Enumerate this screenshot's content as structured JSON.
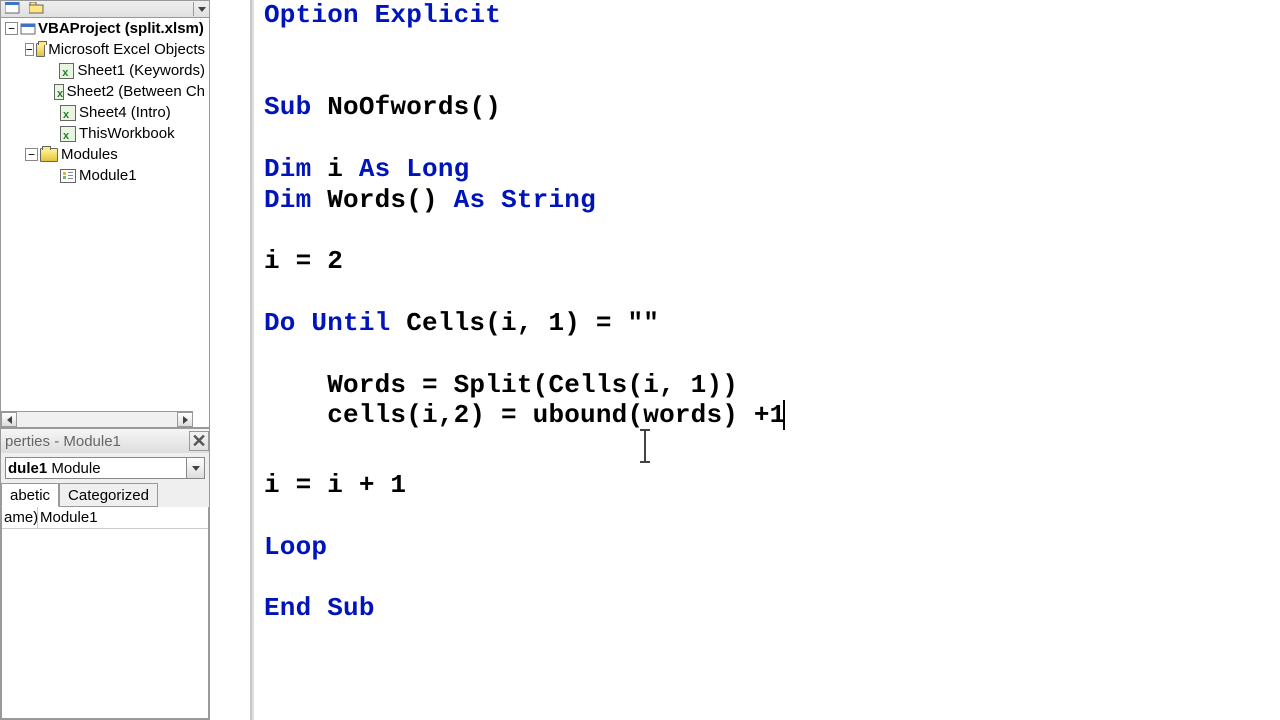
{
  "toolbar": {
    "dropdown": "▾"
  },
  "tree": {
    "project": "VBAProject (split.xlsm)",
    "group_excel": "Microsoft Excel Objects",
    "sheet1": "Sheet1 (Keywords)",
    "sheet2": "Sheet2 (Between Ch",
    "sheet4": "Sheet4 (Intro)",
    "thiswb": "ThisWorkbook",
    "group_modules": "Modules",
    "module1": "Module1"
  },
  "properties": {
    "title": "perties - Module1",
    "combo_bold": "dule1",
    "combo_rest": " Module",
    "tab_alpha": "abetic",
    "tab_cat": "Categorized",
    "row_name_l": "ame)",
    "row_name_r": "Module1"
  },
  "code": {
    "l1_kw": "Option Explicit",
    "l4a": "Sub",
    "l4b": " NoOfwords()",
    "l6a": "Dim",
    "l6b": " i ",
    "l6c": "As Long",
    "l7a": "Dim",
    "l7b": " Words() ",
    "l7c": "As String",
    "l9": "i = 2",
    "l11a": "Do Until",
    "l11b": " Cells(i, 1) = \"\"",
    "l13": "    Words = Split(Cells(i, 1))",
    "l14": "    cells(i,2) = ubound(words) +1",
    "l16": "i = i + 1",
    "l18": "Loop",
    "l20": "End Sub"
  }
}
